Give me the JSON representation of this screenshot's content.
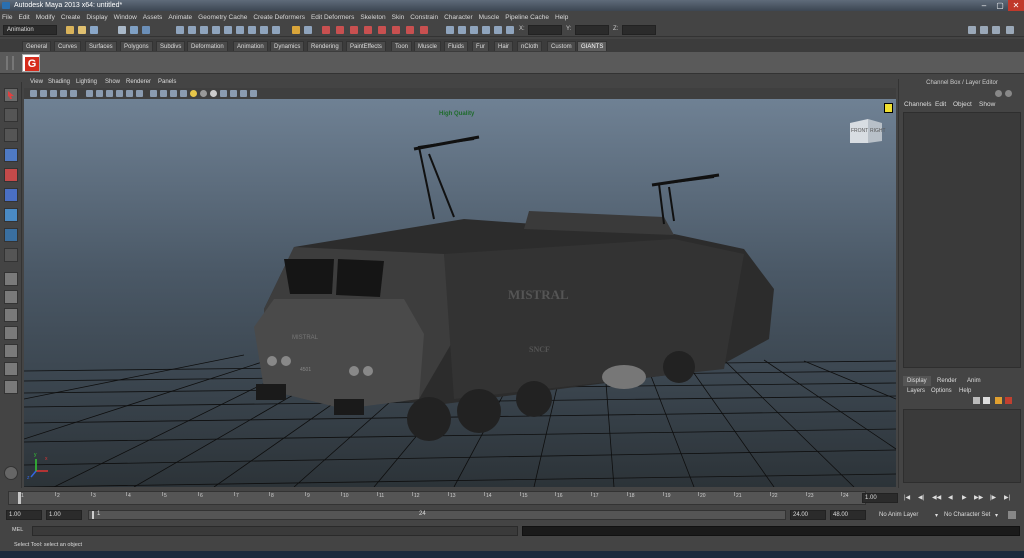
{
  "window": {
    "title": "Autodesk Maya 2013 x64: untitled*",
    "controls": [
      "–",
      "▢",
      "✕"
    ]
  },
  "menubar": [
    "File",
    "Edit",
    "Modify",
    "Create",
    "Display",
    "Window",
    "Assets",
    "Animate",
    "Geometry Cache",
    "Create Deformers",
    "Edit Deformers",
    "Skeleton",
    "Skin",
    "Constrain",
    "Character",
    "Muscle",
    "Pipeline Cache",
    "Help"
  ],
  "statusline": {
    "mode": "Animation",
    "coord_labels": [
      "X:",
      "Y:",
      "Z:"
    ]
  },
  "shelf": {
    "tabs": [
      "General",
      "Curves",
      "Surfaces",
      "Polygons",
      "Subdivs",
      "Deformation",
      "Animation",
      "Dynamics",
      "Rendering",
      "PaintEffects",
      "Toon",
      "Muscle",
      "Fluids",
      "Fur",
      "Hair",
      "nCloth",
      "Custom",
      "GIANTS"
    ],
    "active_tab": "GIANTS",
    "giants_icon": "G"
  },
  "panel": {
    "menu": [
      "View",
      "Shading",
      "Lighting",
      "Show",
      "Renderer",
      "Panels"
    ],
    "hud_label": "High Quality",
    "viewcube": {
      "front": "FRONT",
      "right": "RIGHT"
    },
    "axis_labels": {
      "x": "x",
      "y": "y",
      "z": "z"
    },
    "model_texts": {
      "name": "MISTRAL",
      "operator": "SNCF",
      "badge_name": "MISTRAL",
      "number": "4501"
    }
  },
  "channel_box": {
    "title": "Channel Box / Layer Editor",
    "menu": [
      "Channels",
      "Edit",
      "Object",
      "Show"
    ]
  },
  "layer_editor": {
    "tabs": [
      "Display",
      "Render",
      "Anim"
    ],
    "active_tab": "Display",
    "menu": [
      "Layers",
      "Options",
      "Help"
    ]
  },
  "timeline": {
    "ticks": [
      "1",
      "2",
      "3",
      "4",
      "5",
      "6",
      "7",
      "8",
      "9",
      "10",
      "11",
      "12",
      "13",
      "14",
      "15",
      "16",
      "17",
      "18",
      "19",
      "20",
      "21",
      "22",
      "23",
      "24"
    ],
    "current_frame": "1.00",
    "playback_buttons": [
      "|◀",
      "◀|",
      "◀◀",
      "◀",
      "▶",
      "▶▶",
      "|▶",
      "▶|"
    ]
  },
  "range": {
    "start": "1.00",
    "playback_start": "1.00",
    "slider_start_label": "1",
    "slider_end_label": "24",
    "playback_end": "24.00",
    "end": "48.00",
    "anim_layer": "No Anim Layer",
    "character_set": "No Character Set"
  },
  "command_line": {
    "label": "MEL"
  },
  "help_line": "Select Tool: select an object",
  "colors": {
    "accent_red": "#d62b1c",
    "viewport_top": "#6f8194",
    "viewport_bottom": "#2c3338",
    "hud_green": "#1e6b2b"
  }
}
